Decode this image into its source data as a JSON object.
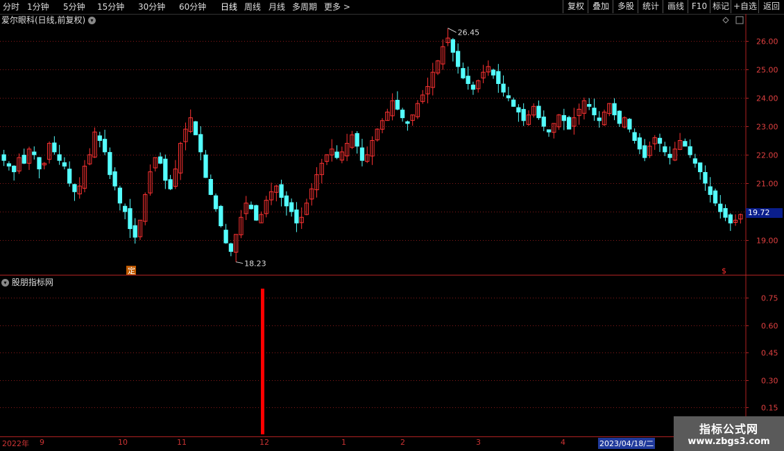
{
  "toolbar": {
    "periods": [
      "分时",
      "1分钟",
      "5分钟",
      "15分钟",
      "30分钟",
      "60分钟",
      "日线",
      "周线",
      "月线",
      "多周期",
      "更多 >"
    ],
    "active": "日线",
    "right_buttons": [
      "复权",
      "叠加",
      "多股",
      "统计",
      "画线",
      "F10",
      "标记",
      "+自选",
      "返回"
    ]
  },
  "main": {
    "title": "爱尔眼科(日线,前复权)",
    "high_label": "26.45",
    "low_label": "18.23",
    "last_price": "19.72",
    "marker_ding": "定",
    "marker_s": "$",
    "y_ticks": [
      "26.00",
      "25.00",
      "24.00",
      "23.00",
      "22.00",
      "21.00",
      "19.00"
    ]
  },
  "sub": {
    "title": "股朋指标网",
    "y_ticks": [
      "0.75",
      "0.60",
      "0.45",
      "0.30",
      "0.15"
    ]
  },
  "dates": {
    "labels": [
      "2022年",
      "9",
      "10",
      "11",
      "12",
      "1",
      "2",
      "3",
      "4"
    ],
    "highlight": "2023/04/18/二"
  },
  "watermark": {
    "line1": "指标公式网",
    "line2": "www.zbgs3.com"
  },
  "colors": {
    "up": "#ff3232",
    "down": "#54ffff",
    "grid": "#8b1a1a",
    "axis": "#b22222",
    "signal": "#ff0000"
  },
  "chart_data": {
    "type": "candlestick",
    "title": "爱尔眼科(日线,前复权)",
    "ylim": [
      18.0,
      26.5
    ],
    "period": "2022-08 to 2023-04",
    "closes": [
      21.8,
      21.6,
      21.4,
      21.9,
      21.7,
      22.2,
      22.0,
      21.5,
      21.7,
      22.4,
      22.1,
      21.8,
      21.6,
      21.0,
      20.7,
      20.9,
      21.6,
      22.0,
      22.8,
      22.5,
      22.1,
      21.3,
      20.9,
      20.3,
      20.0,
      19.4,
      19.1,
      19.7,
      20.6,
      21.4,
      21.9,
      21.7,
      21.1,
      20.8,
      21.5,
      22.4,
      22.9,
      23.3,
      22.7,
      22.1,
      21.2,
      20.6,
      20.1,
      19.5,
      18.9,
      18.6,
      19.2,
      19.8,
      20.3,
      20.1,
      19.7,
      19.9,
      20.4,
      20.7,
      20.9,
      20.5,
      20.2,
      20.0,
      19.6,
      19.8,
      20.3,
      20.8,
      21.3,
      21.7,
      22.0,
      22.2,
      21.9,
      22.1,
      22.4,
      22.7,
      22.3,
      21.8,
      22.0,
      22.5,
      22.9,
      23.2,
      23.5,
      23.9,
      23.6,
      23.3,
      23.1,
      23.4,
      23.8,
      24.1,
      24.4,
      24.9,
      25.3,
      25.8,
      26.1,
      25.6,
      25.1,
      24.7,
      24.5,
      24.3,
      24.6,
      24.9,
      25.1,
      24.8,
      24.5,
      24.2,
      24.0,
      23.7,
      23.5,
      23.2,
      23.4,
      23.7,
      23.3,
      23.0,
      22.8,
      23.1,
      23.4,
      23.2,
      22.9,
      23.3,
      23.6,
      23.9,
      23.7,
      23.4,
      23.2,
      23.5,
      23.8,
      23.4,
      23.1,
      23.3,
      22.9,
      22.5,
      22.2,
      21.9,
      22.3,
      22.6,
      22.4,
      22.1,
      21.9,
      22.2,
      22.5,
      22.3,
      22.0,
      21.7,
      21.4,
      21.0,
      20.6,
      20.3,
      20.0,
      19.8,
      19.6,
      19.7,
      19.9
    ]
  },
  "sub_chart_data": {
    "type": "bar",
    "value": 0.8,
    "ylim": [
      0,
      0.85
    ]
  }
}
